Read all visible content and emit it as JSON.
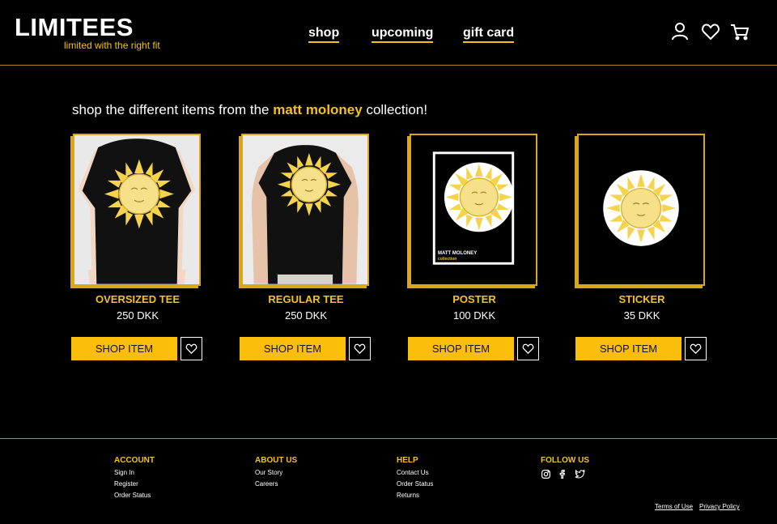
{
  "brand": {
    "name": "LIMITEES",
    "tagline": "limited with the right fit",
    "accent": "#f4c21f"
  },
  "nav": {
    "items": [
      "shop",
      "upcoming",
      "gift card"
    ]
  },
  "header_icons": [
    "user-icon",
    "heart-icon",
    "cart-icon"
  ],
  "intro": {
    "before": "shop the different items from the ",
    "highlight": "matt moloney",
    "after": " collection!"
  },
  "products": [
    {
      "name": "OVERSIZED TEE",
      "price": "250 DKK",
      "shop_label": "SHOP ITEM"
    },
    {
      "name": "REGULAR TEE",
      "price": "250 DKK",
      "shop_label": "SHOP ITEM"
    },
    {
      "name": "POSTER",
      "price": "100 DKK",
      "shop_label": "SHOP ITEM",
      "poster_text": [
        "MATT MOLONEY",
        "collection"
      ]
    },
    {
      "name": "STICKER",
      "price": "35 DKK",
      "shop_label": "SHOP ITEM"
    }
  ],
  "footer": {
    "account": {
      "title": "ACCOUNT",
      "links": [
        "Sign In",
        "Register",
        "Order Status"
      ]
    },
    "about": {
      "title": "ABOUT US",
      "links": [
        "Our Story",
        "Careers"
      ]
    },
    "help": {
      "title": "HELP",
      "links": [
        "Contact Us",
        "Order Status",
        "Returns"
      ]
    },
    "follow": {
      "title": "FOLLOW US",
      "icons": [
        "instagram-icon",
        "facebook-icon",
        "twitter-icon"
      ]
    },
    "legal": [
      "Terms of Use",
      "Privacy Policy"
    ]
  }
}
